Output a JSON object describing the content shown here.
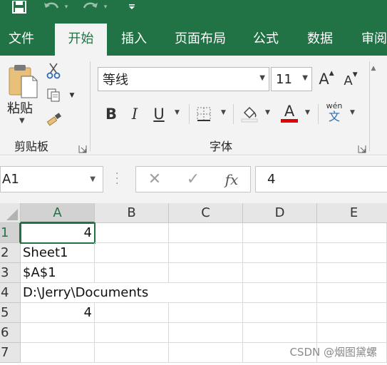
{
  "tabs": [
    "文件",
    "开始",
    "插入",
    "页面布局",
    "公式",
    "数据",
    "审阅"
  ],
  "active_tab": "开始",
  "clipboard": {
    "paste_label": "粘贴",
    "group_label": "剪贴板"
  },
  "font": {
    "name": "等线",
    "size": "11",
    "group_label": "字体",
    "bold": "B",
    "italic": "I",
    "underline": "U",
    "font_color_letter": "A",
    "grow_letter": "A",
    "shrink_letter": "A",
    "phonetic_top": "wén",
    "phonetic_bottom": "文",
    "font_color": "#e00000"
  },
  "formula_bar": {
    "name_box": "A1",
    "cancel_symbol": "✕",
    "enter_symbol": "✓",
    "fx_label": "fx",
    "value": "4"
  },
  "columns": [
    "A",
    "B",
    "C",
    "D",
    "E"
  ],
  "rows": [
    "1",
    "2",
    "3",
    "4",
    "5",
    "6",
    "7"
  ],
  "cells": {
    "A1": "4",
    "A2": "Sheet1",
    "A3": "$A$1",
    "A4": "D:\\Jerry\\Documents",
    "A5": "4"
  },
  "selected_cell": "A1",
  "watermark": "CSDN @烟图黛螺",
  "colors": {
    "excel_green": "#217346",
    "ribbon_bg": "#f3f3f3",
    "header_bg": "#e6e6e6"
  }
}
